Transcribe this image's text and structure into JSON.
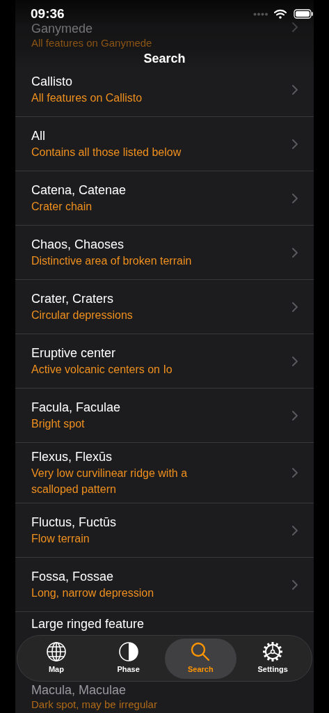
{
  "status_bar": {
    "time": "09:36"
  },
  "title": "Search",
  "rows": [
    {
      "title": "Ganymede",
      "subtitle": "All features on Ganymede"
    },
    {
      "title": "Callisto",
      "subtitle": "All features on Callisto"
    },
    {
      "title": "All",
      "subtitle": "Contains all those listed below"
    },
    {
      "title": "Catena, Catenae",
      "subtitle": "Crater chain"
    },
    {
      "title": "Chaos, Chaoses",
      "subtitle": "Distinctive area of broken terrain"
    },
    {
      "title": "Crater, Craters",
      "subtitle": "Circular depressions"
    },
    {
      "title": "Eruptive center",
      "subtitle": "Active volcanic centers on Io"
    },
    {
      "title": "Facula, Faculae",
      "subtitle": "Bright spot"
    },
    {
      "title": "Flexus, Flexūs",
      "subtitle": "Very low curvilinear ridge with a scalloped pattern"
    },
    {
      "title": "Fluctus, Fuctūs",
      "subtitle": "Flow terrain"
    },
    {
      "title": "Fossa, Fossae",
      "subtitle": "Long, narrow depression"
    },
    {
      "title": "Large ringed feature"
    },
    {
      "title": "Macula, Maculae",
      "subtitle": "Dark spot, may be irregular"
    }
  ],
  "tabs": [
    {
      "label": "Map",
      "kind": "globe",
      "selected": false
    },
    {
      "label": "Phase",
      "kind": "phase",
      "selected": false
    },
    {
      "label": "Search",
      "kind": "search",
      "selected": true
    },
    {
      "label": "Settings",
      "kind": "gear",
      "selected": false
    }
  ]
}
